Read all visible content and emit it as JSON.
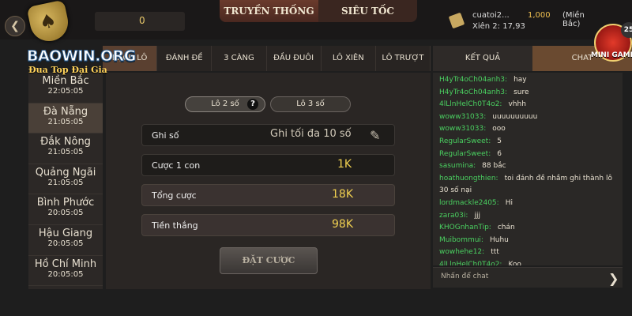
{
  "header": {
    "back_icon": "chevron-left-icon",
    "logo_text": "BAOWIN.ORG",
    "logo_tagline": "Đua Top Đại Gia",
    "coin_value": "0",
    "mode_tabs": [
      "TRUYỀN THỐNG",
      "SIÊU TỐC"
    ],
    "account": {
      "username": "cuatoi2...",
      "balance": "1,000",
      "region": "(Miền Bắc)",
      "xien": "Xiên 2: 17,93"
    },
    "minigame": {
      "label": "MINI GAME",
      "badge": "25"
    }
  },
  "regions": [
    {
      "name": "Miền Bắc",
      "time": "22:05:05"
    },
    {
      "name": "Đà Nẵng",
      "time": "21:05:05"
    },
    {
      "name": "Đắk Nông",
      "time": "21:05:05"
    },
    {
      "name": "Quảng Ngãi",
      "time": "21:05:05"
    },
    {
      "name": "Bình Phước",
      "time": "20:05:05"
    },
    {
      "name": "Hậu Giang",
      "time": "20:05:05"
    },
    {
      "name": "Hồ Chí Minh",
      "time": "20:05:05"
    }
  ],
  "game_tabs": [
    "BẠCH LÔ",
    "ĐÁNH ĐỀ",
    "3 CÀNG",
    "ĐẦU ĐUÔI",
    "LÔ XIÊN",
    "LÔ TRƯỢT"
  ],
  "bet_types": {
    "lo2": "Lô 2 số",
    "lo3": "Lô 3 số",
    "help": "?"
  },
  "form": {
    "ghi_so_label": "Ghi số",
    "ghi_so_placeholder": "Ghi tối đa 10 số",
    "cuoc_label": "Cược 1 con",
    "cuoc_value": "1K",
    "tong_label": "Tổng cược",
    "tong_value": "18K",
    "thang_label": "Tiền thắng",
    "thang_value": "98K",
    "submit": "ĐẶT CƯỢC"
  },
  "right_tabs": [
    "KẾT QUẢ",
    "CHAT"
  ],
  "chat": {
    "messages": [
      {
        "user": "H4yTr4oCh04anh3:",
        "text": "hay"
      },
      {
        "user": "H4yTr4oCh04anh3:",
        "text": "sure"
      },
      {
        "user": "4lLlnHelCh0T4o2:",
        "text": "vhhh"
      },
      {
        "user": "woww31033:",
        "text": "uuuuuuuuuu"
      },
      {
        "user": "woww31033:",
        "text": "ooo"
      },
      {
        "user": "RegularSweet:",
        "text": "5"
      },
      {
        "user": "RegularSweet:",
        "text": "6"
      },
      {
        "user": "sasumina:",
        "text": "88 bắc"
      },
      {
        "user": "hoathuongthien:",
        "text": "toi đánh đề nhầm ghi thành lô 30 số nại"
      },
      {
        "user": "lordmackle2405:",
        "text": "Hi"
      },
      {
        "user": "zara03i:",
        "text": "jjj"
      },
      {
        "user": "KHOGnhanTip:",
        "text": "chán"
      },
      {
        "user": "Muibommui:",
        "text": "Huhu"
      },
      {
        "user": "wowhehe12:",
        "text": "ttt"
      },
      {
        "user": "4lLlnHelCh0T4o2:",
        "text": "Koo"
      }
    ],
    "input_placeholder": "Nhấn để chat",
    "send_icon": "chevron-right-icon"
  },
  "colors": {
    "accent_gold": "#f0c050",
    "chat_user": "#4ad060",
    "active_tab": "#5a4030"
  }
}
